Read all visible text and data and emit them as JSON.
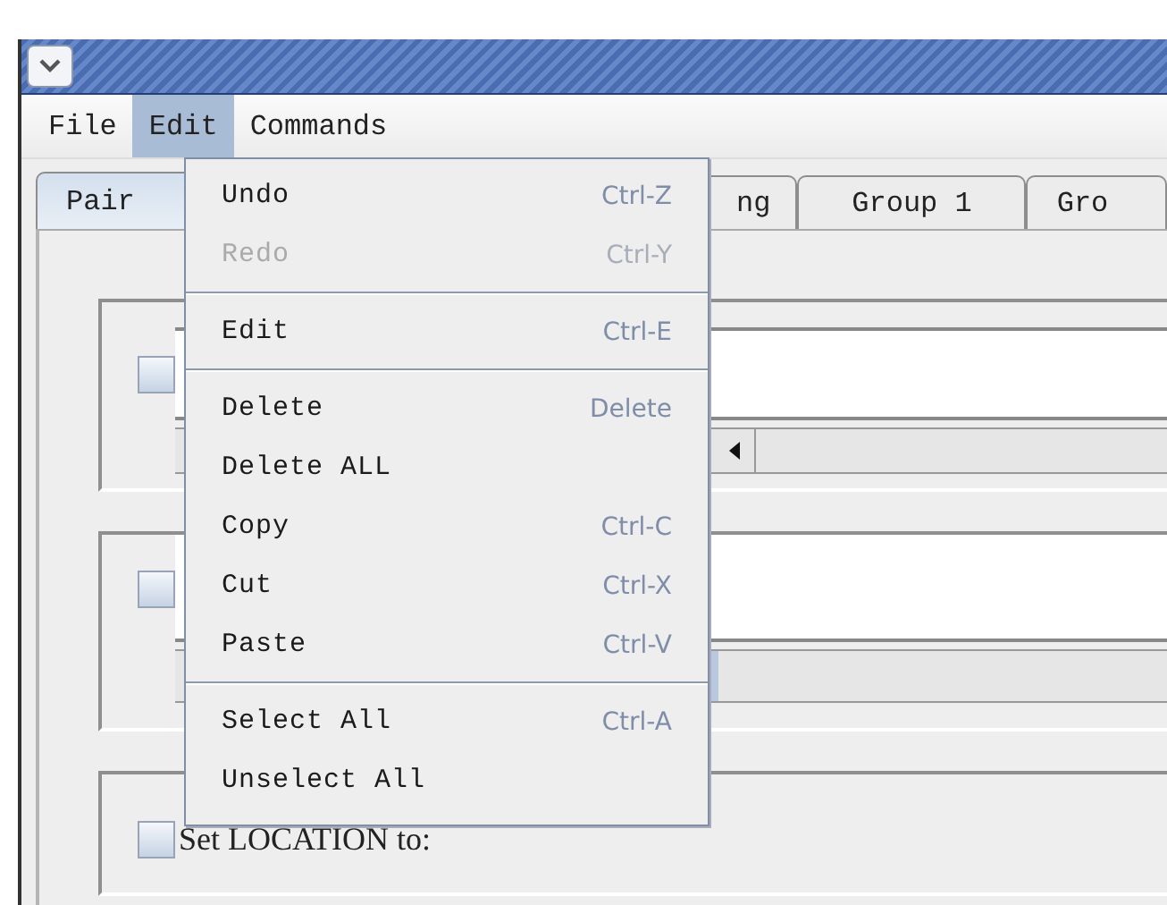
{
  "menu_bar": [
    {
      "label": "File",
      "selected": false
    },
    {
      "label": "Edit",
      "selected": true
    },
    {
      "label": "Commands",
      "selected": false
    }
  ],
  "tabs": [
    {
      "label": "Pair",
      "selected": true
    },
    {
      "label": "ng",
      "selected": false
    },
    {
      "label": "Group 1",
      "selected": false
    },
    {
      "label": "Gro",
      "selected": false
    }
  ],
  "groups": [
    {
      "kind": "field-scroll",
      "checked": false
    },
    {
      "kind": "field-bar",
      "checked": false
    },
    {
      "kind": "label",
      "checked": false,
      "label": "Set LOCATION to:"
    }
  ],
  "edit_menu": [
    {
      "kind": "item",
      "label": "Undo",
      "shortcut": "Ctrl-Z",
      "disabled": false
    },
    {
      "kind": "item",
      "label": "Redo",
      "shortcut": "Ctrl-Y",
      "disabled": true
    },
    {
      "kind": "separator"
    },
    {
      "kind": "item",
      "label": "Edit",
      "shortcut": "Ctrl-E",
      "disabled": false
    },
    {
      "kind": "separator"
    },
    {
      "kind": "item",
      "label": "Delete",
      "shortcut": "Delete",
      "disabled": false
    },
    {
      "kind": "item",
      "label": "Delete ALL",
      "disabled": false
    },
    {
      "kind": "item",
      "label": "Copy",
      "shortcut": "Ctrl-C",
      "disabled": false
    },
    {
      "kind": "item",
      "label": "Cut",
      "shortcut": "Ctrl-X",
      "disabled": false
    },
    {
      "kind": "item",
      "label": "Paste",
      "shortcut": "Ctrl-V",
      "disabled": false
    },
    {
      "kind": "separator"
    },
    {
      "kind": "item",
      "label": "Select All",
      "shortcut": "Ctrl-A",
      "disabled": false
    },
    {
      "kind": "item",
      "label": "Unselect All",
      "disabled": false
    }
  ]
}
